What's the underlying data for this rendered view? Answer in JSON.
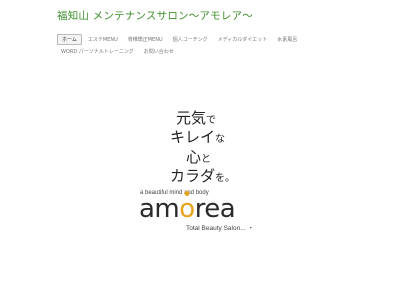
{
  "site": {
    "title": "福知山 メンテナンスサロン〜アモレア〜"
  },
  "nav": {
    "row1": [
      {
        "label": "ホーム",
        "active": true
      },
      {
        "label": "エステMENU"
      },
      {
        "label": "脊椎矯正MENU"
      },
      {
        "label": "個人コーチング"
      },
      {
        "label": "メディカルダイエット"
      },
      {
        "label": "水素風呂"
      }
    ],
    "row2": [
      {
        "label": "WORD パーソナルトレーニング"
      },
      {
        "label": "お問い合わせ"
      }
    ]
  },
  "hero": {
    "line1_big": "元気",
    "line1_small": "で",
    "line2_big": "キレイ",
    "line2_small": "な",
    "line3_big": "心",
    "line3_small": "と",
    "line4_big": "カラダ",
    "line4_small": "を。",
    "tagline": "a beautiful mind and body",
    "logo_part1": "am",
    "logo_o": "o",
    "logo_part2": "rea",
    "subtitle": "Total Beauty Salon...",
    "trailing_mark": "・"
  },
  "colors": {
    "title_green": "#3f8f2d",
    "logo_orange": "#e8a21c"
  }
}
